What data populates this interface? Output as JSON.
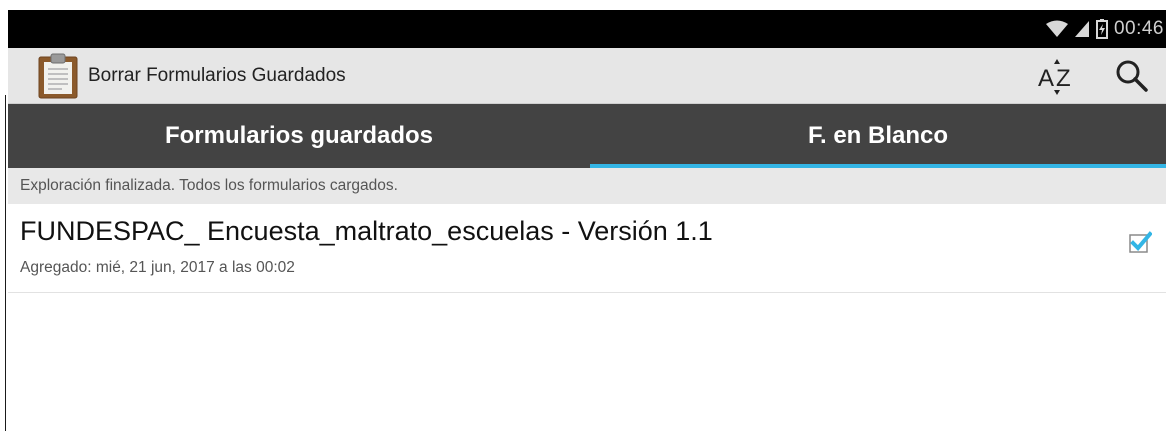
{
  "status_bar": {
    "time": "00:46",
    "icons": [
      "wifi-icon",
      "signal-icon",
      "battery-icon"
    ]
  },
  "action_bar": {
    "title": "Borrar Formularios Guardados",
    "app_icon": "clipboard-icon",
    "actions": [
      "sort-az-icon",
      "search-icon"
    ]
  },
  "tabs": [
    {
      "label": "Formularios guardados",
      "selected": false
    },
    {
      "label": "F. en Blanco",
      "selected": true
    }
  ],
  "notice": "Exploración finalizada. Todos los formularios cargados.",
  "forms": [
    {
      "title": "FUNDESPAC_ Encuesta_maltrato_escuelas - Versión 1.1",
      "subtitle": "Agregado: mié, 21 jun, 2017 a las 00:02",
      "checked": true
    }
  ],
  "colors": {
    "status_bar": "#000000",
    "action_bar": "#e6e6e6",
    "tab_bar": "#434343",
    "tab_indicator": "#33b5e5",
    "checkbox": "#33b5e5"
  }
}
